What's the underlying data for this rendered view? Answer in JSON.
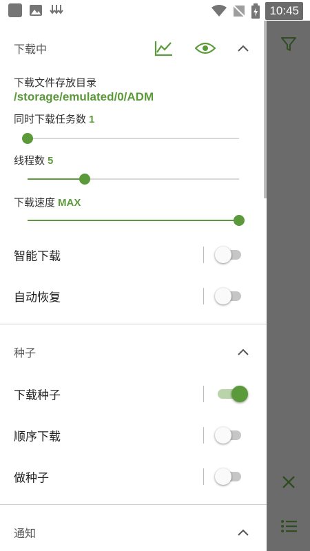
{
  "status_bar": {
    "time": "10:45"
  },
  "colors": {
    "accent": "#5b9a3a",
    "scrim": "#6b6b6b"
  },
  "download": {
    "header": "下载中",
    "dir_label": "下载文件存放目录",
    "dir_path": "/storage/emulated/0/ADM",
    "tasks_label": "同时下载任务数",
    "tasks_value": "1",
    "tasks_fraction": 0.0,
    "threads_label": "线程数",
    "threads_value": "5",
    "threads_fraction": 0.27,
    "speed_label": "下载速度",
    "speed_value": "MAX",
    "speed_fraction": 1.0,
    "smart_label": "智能下载",
    "smart_on": false,
    "resume_label": "自动恢复",
    "resume_on": false
  },
  "torrent": {
    "header": "种子",
    "download_label": "下载种子",
    "download_on": true,
    "sequential_label": "顺序下载",
    "sequential_on": false,
    "seed_label": "做种子",
    "seed_on": false
  },
  "notify": {
    "header": "通知"
  },
  "icons": [
    "chart-icon",
    "eye-icon",
    "chevron-up-icon",
    "filter-icon",
    "close-icon",
    "list-icon"
  ]
}
